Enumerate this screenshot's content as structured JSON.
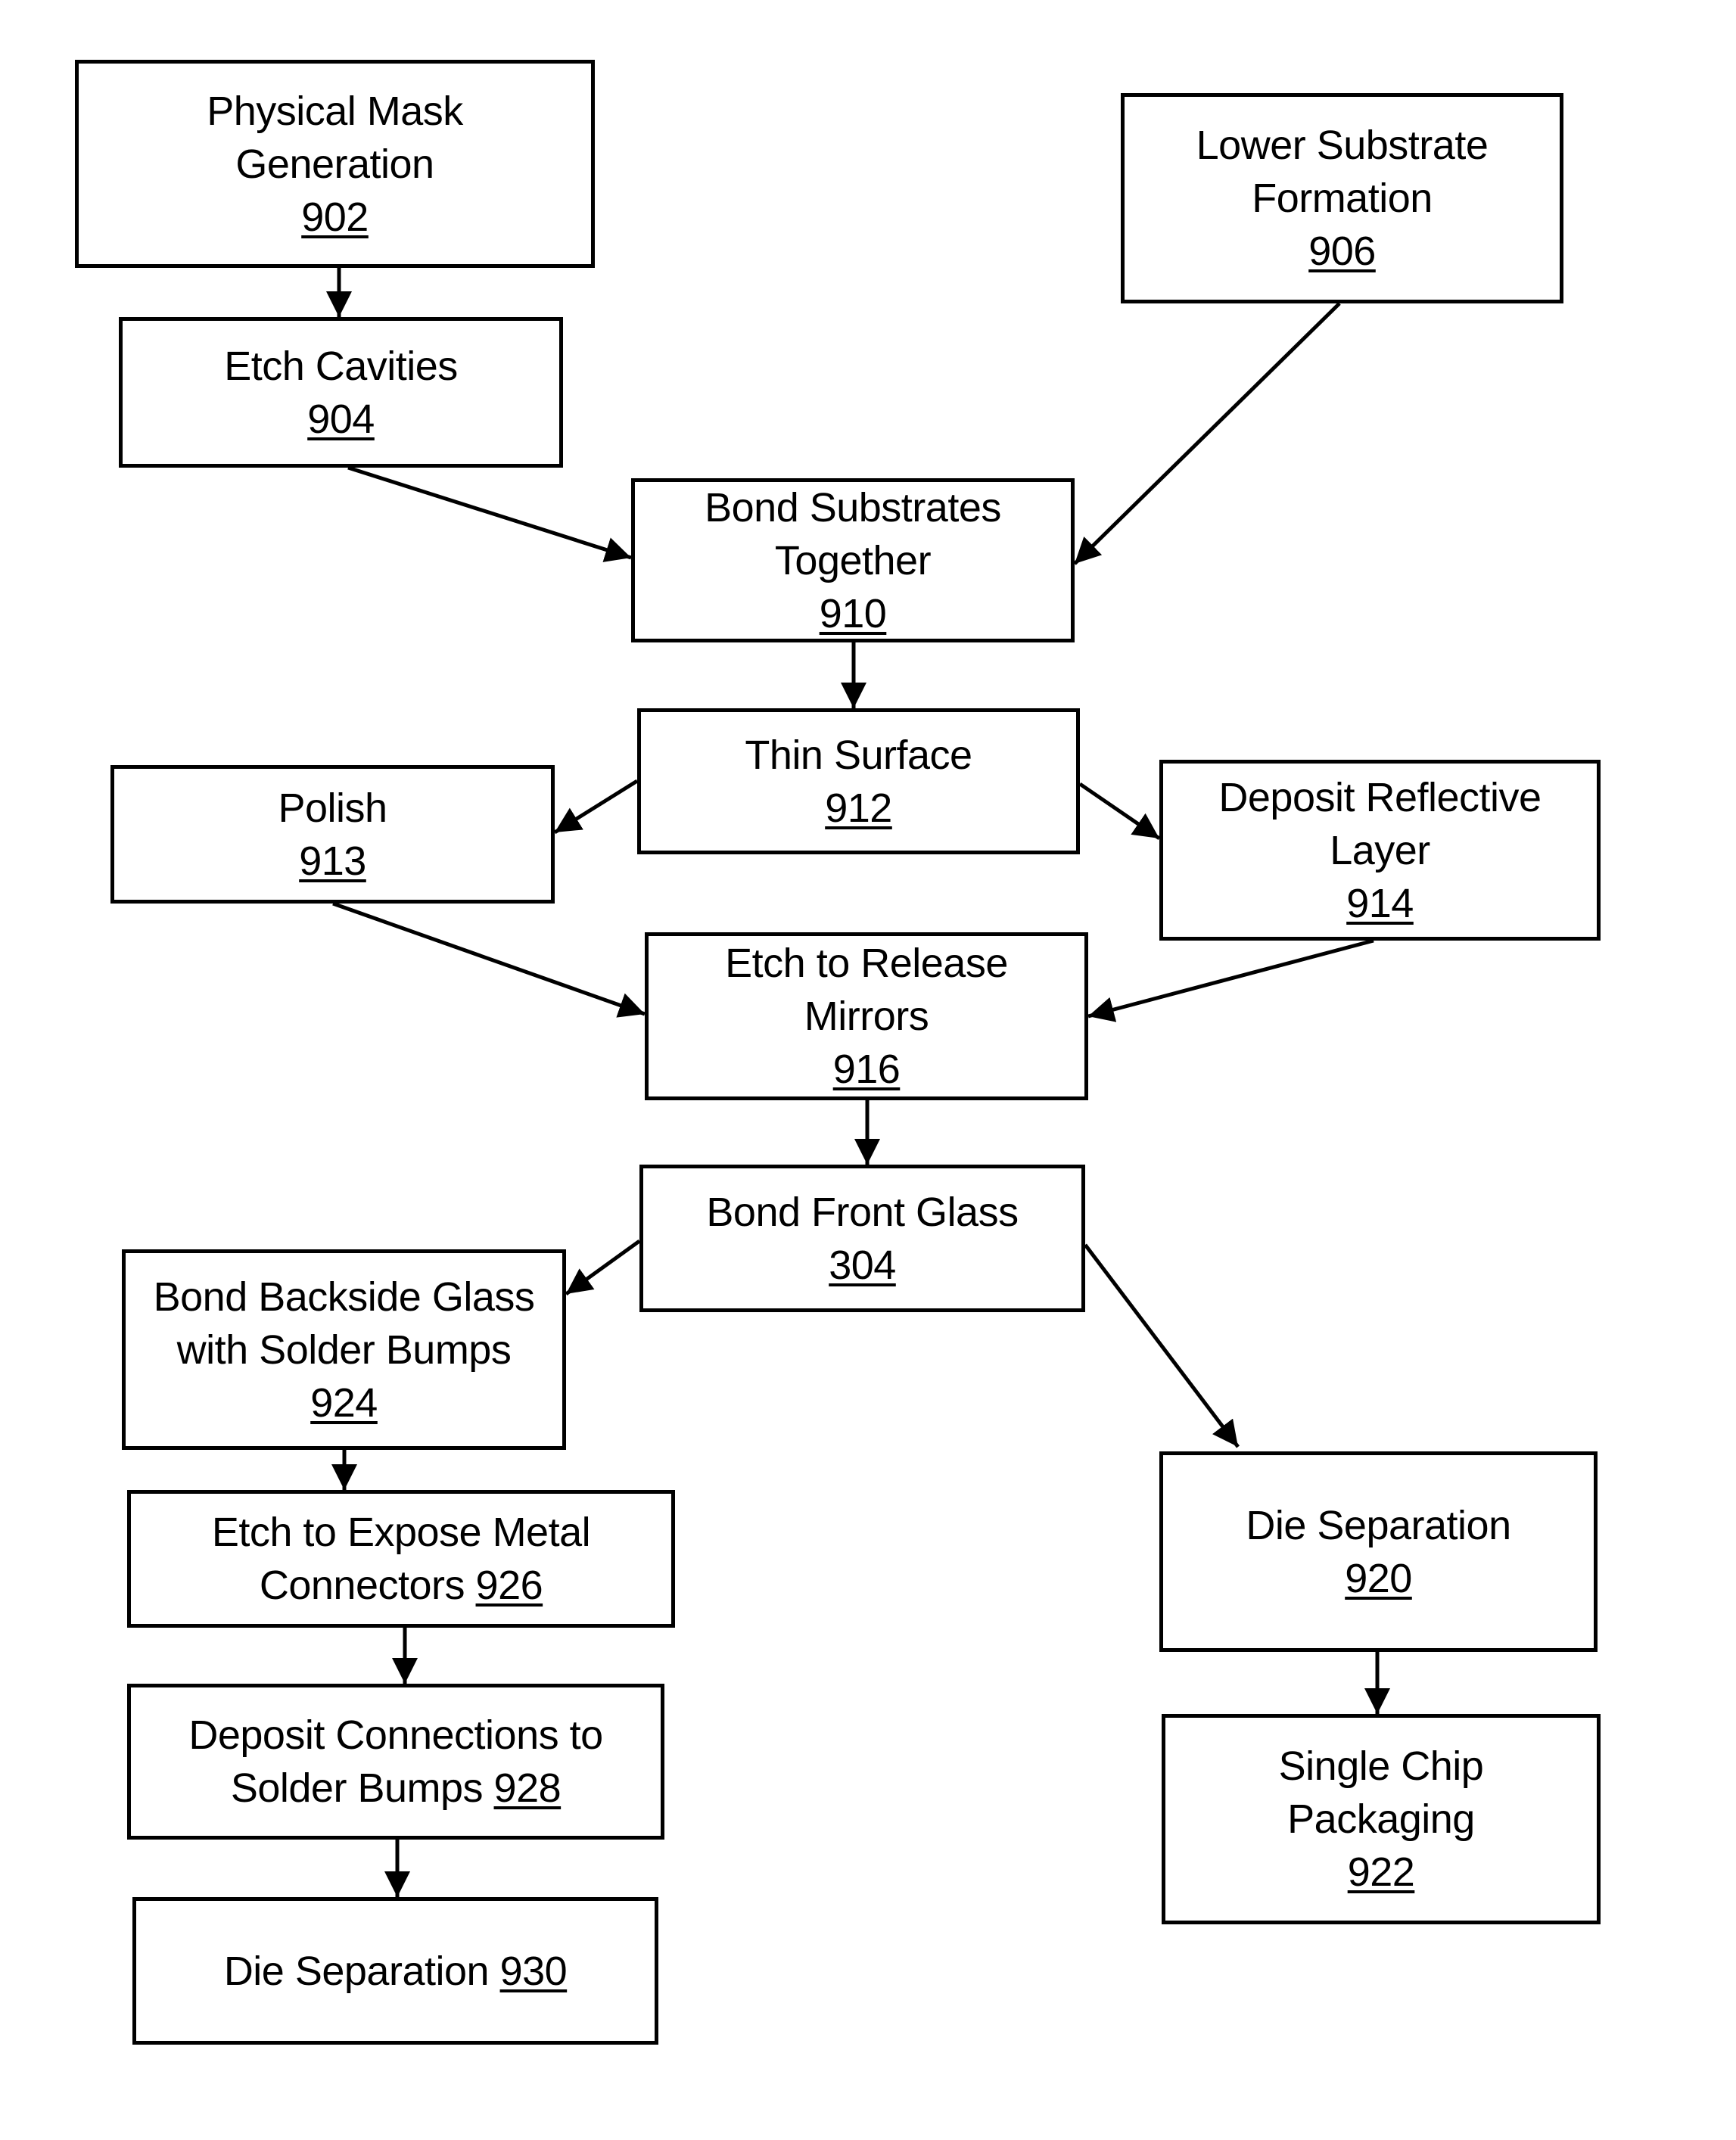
{
  "diagram": {
    "type": "flowchart",
    "nodes": [
      {
        "id": "902",
        "lines": [
          "Physical Mask",
          "Generation"
        ],
        "ref": "902",
        "ref_inline": false
      },
      {
        "id": "906",
        "lines": [
          "Lower Substrate",
          "Formation"
        ],
        "ref": "906",
        "ref_inline": false
      },
      {
        "id": "904",
        "lines": [
          "Etch Cavities"
        ],
        "ref": "904",
        "ref_inline": false
      },
      {
        "id": "910",
        "lines": [
          "Bond Substrates",
          "Together"
        ],
        "ref": "910",
        "ref_inline": false
      },
      {
        "id": "912",
        "lines": [
          "Thin Surface"
        ],
        "ref": "912",
        "ref_inline": false
      },
      {
        "id": "913",
        "lines": [
          "Polish"
        ],
        "ref": "913",
        "ref_inline": false
      },
      {
        "id": "914",
        "lines": [
          "Deposit Reflective",
          "Layer"
        ],
        "ref": "914",
        "ref_inline": false
      },
      {
        "id": "916",
        "lines": [
          "Etch to Release",
          "Mirrors"
        ],
        "ref": "916",
        "ref_inline": false
      },
      {
        "id": "304",
        "lines": [
          "Bond Front Glass"
        ],
        "ref": "304",
        "ref_inline": false
      },
      {
        "id": "924",
        "lines": [
          "Bond Backside Glass",
          "with Solder Bumps"
        ],
        "ref": "924",
        "ref_inline": false
      },
      {
        "id": "926",
        "lines": [
          "Etch to Expose Metal",
          "Connectors"
        ],
        "ref": "926",
        "ref_inline": true
      },
      {
        "id": "928",
        "lines": [
          "Deposit Connections to",
          "Solder Bumps"
        ],
        "ref": "928",
        "ref_inline": true
      },
      {
        "id": "930",
        "lines": [
          "Die Separation"
        ],
        "ref": "930",
        "ref_inline": true
      },
      {
        "id": "920",
        "lines": [
          "Die Separation"
        ],
        "ref": "920",
        "ref_inline": false
      },
      {
        "id": "922",
        "lines": [
          "Single Chip",
          "Packaging"
        ],
        "ref": "922",
        "ref_inline": false
      }
    ],
    "edges": [
      {
        "from": "902",
        "to": "904"
      },
      {
        "from": "904",
        "to": "910"
      },
      {
        "from": "906",
        "to": "910"
      },
      {
        "from": "910",
        "to": "912"
      },
      {
        "from": "912",
        "to": "913"
      },
      {
        "from": "912",
        "to": "914"
      },
      {
        "from": "913",
        "to": "916"
      },
      {
        "from": "914",
        "to": "916"
      },
      {
        "from": "916",
        "to": "304"
      },
      {
        "from": "304",
        "to": "924"
      },
      {
        "from": "304",
        "to": "920"
      },
      {
        "from": "924",
        "to": "926"
      },
      {
        "from": "926",
        "to": "928"
      },
      {
        "from": "928",
        "to": "930"
      },
      {
        "from": "920",
        "to": "922"
      }
    ]
  }
}
